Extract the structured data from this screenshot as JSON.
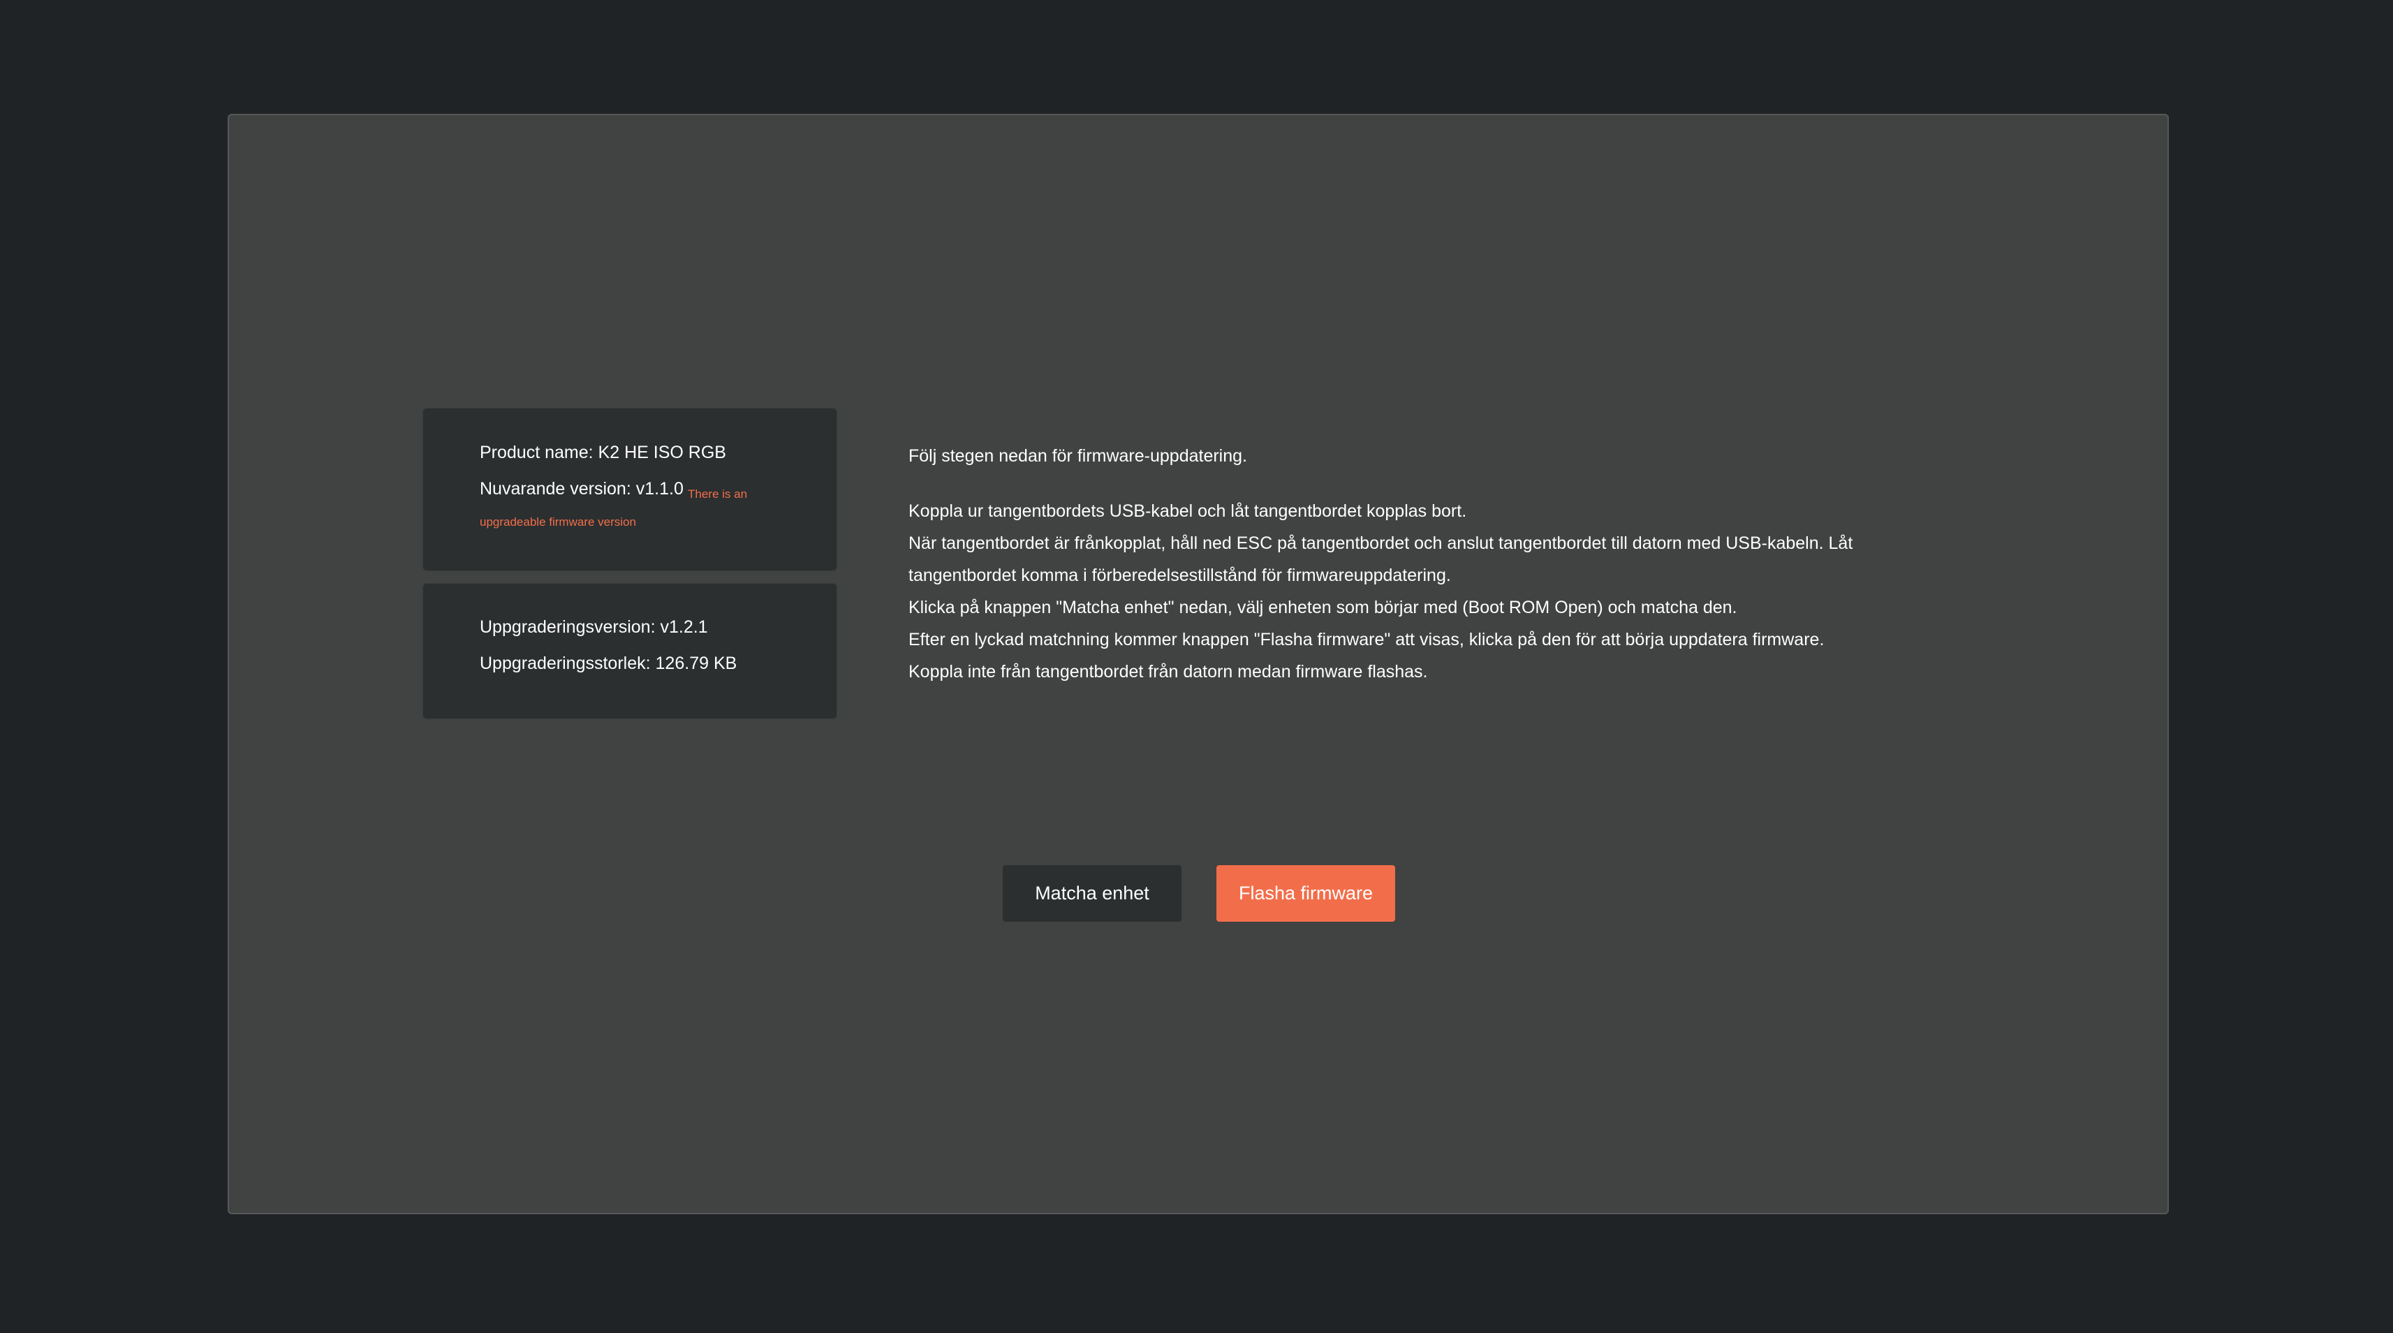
{
  "product_card": {
    "name_label": "Product name:",
    "name_value": "K2 HE ISO RGB",
    "version_label": "Nuvarande version:",
    "version_value": "v1.1.0",
    "upgrade_note": "There is an upgradeable firmware version"
  },
  "upgrade_card": {
    "version_label": "Uppgraderingsversion:",
    "version_value": "v1.2.1",
    "size_label": "Uppgraderingsstorlek:",
    "size_value": "126.79 KB"
  },
  "instructions": {
    "intro": "Följ stegen nedan för firmware-uppdatering.",
    "steps": [
      "Koppla ur tangentbordets USB-kabel och låt tangentbordet kopplas bort.",
      "När tangentbordet är frånkopplat, håll ned ESC på tangentbordet och anslut tangentbordet till datorn med USB-kabeln. Låt tangentbordet komma i förberedelsestillstånd för firmwareuppdatering.",
      "Klicka på knappen \"Matcha enhet\" nedan, välj enheten som börjar med (Boot ROM Open) och matcha den.",
      "Efter en lyckad matchning kommer knappen \"Flasha firmware\" att visas, klicka på den för att börja uppdatera firmware.",
      "Koppla inte från tangentbordet från datorn medan firmware flashas."
    ]
  },
  "buttons": {
    "match_label": "Matcha enhet",
    "flash_label": "Flasha firmware"
  },
  "colors": {
    "accent": "#f26e4b",
    "page_bg": "#1f2325",
    "panel_bg": "#414242",
    "card_bg": "#2b2f30"
  }
}
